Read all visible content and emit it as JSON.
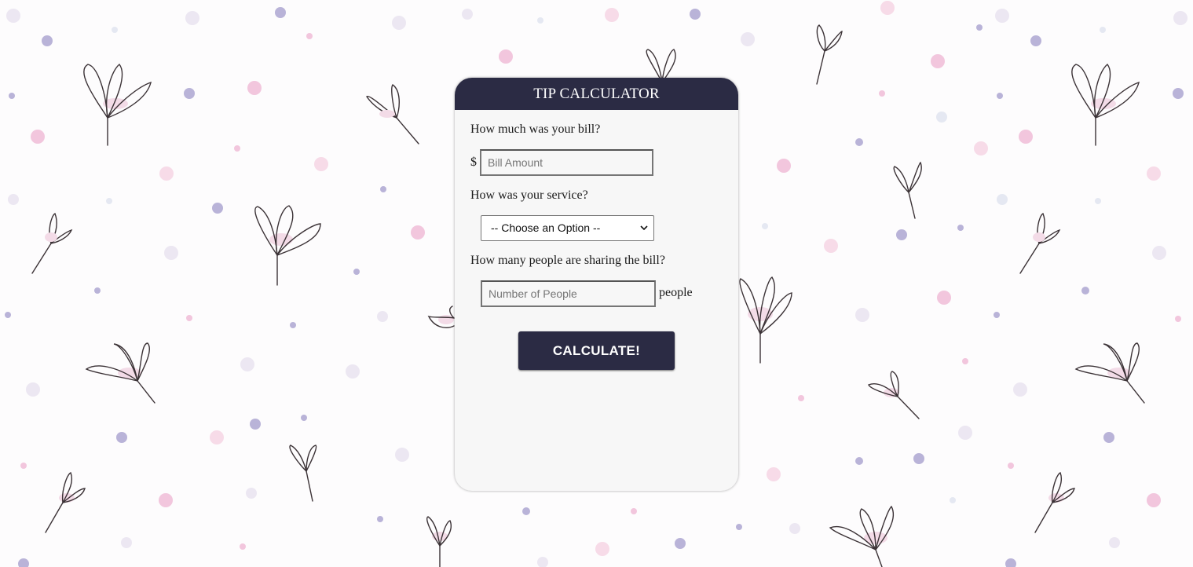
{
  "header": {
    "title": "TIP CALCULATOR"
  },
  "bill": {
    "question": "How much was your bill?",
    "currency": "$",
    "placeholder": "Bill Amount",
    "value": ""
  },
  "service": {
    "question": "How was your service?",
    "selected": "-- Choose an Option --"
  },
  "people": {
    "question": "How many people are sharing the bill?",
    "placeholder": "Number of People",
    "value": "",
    "suffix": "people"
  },
  "calculate": {
    "label": "CALCULATE!"
  },
  "colors": {
    "header_bg": "#2b2b44",
    "card_bg": "#f7f7f7",
    "button_bg": "#2b2b44",
    "dot_purple": "#b9b3d8",
    "dot_pink": "#f2c6dd"
  },
  "background": {
    "pattern": "floral-dots-pattern"
  }
}
